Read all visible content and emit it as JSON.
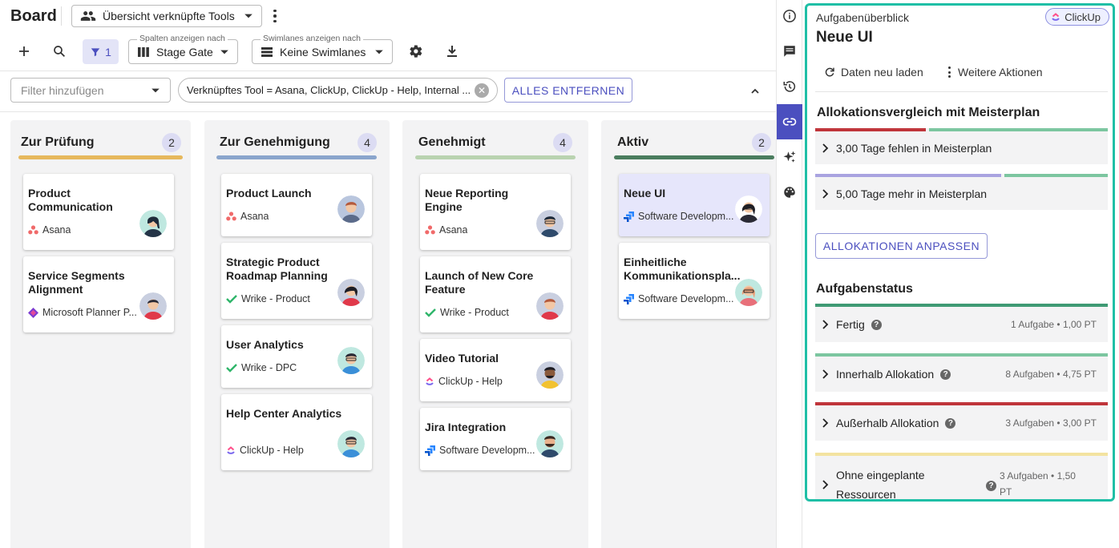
{
  "header": {
    "title": "Board",
    "view_select": "Übersicht verknüpfte Tools",
    "filter_count": "1",
    "columns_select": {
      "label": "Spalten anzeigen nach",
      "value": "Stage Gate"
    },
    "swimlanes_select": {
      "label": "Swimlanes anzeigen nach",
      "value": "Keine Swimlanes"
    },
    "filter_placeholder": "Filter hinzufügen",
    "filter_chip": "Verknüpftes Tool = Asana, ClickUp, ClickUp - Help, Internal ...",
    "clear_all": "ALLES ENTFERNEN"
  },
  "columns": [
    {
      "title": "Zur Prüfung",
      "count": "2",
      "color": "#e6b85c",
      "cards": [
        {
          "title": "Product Communication",
          "tool": "Asana"
        },
        {
          "title": "Service Segments Alignment",
          "tool": "Microsoft Planner P..."
        }
      ]
    },
    {
      "title": "Zur Genehmigung",
      "count": "4",
      "color": "#8aa5cc",
      "cards": [
        {
          "title": "Product Launch",
          "tool": "Asana"
        },
        {
          "title": "Strategic Product Roadmap Planning",
          "tool": "Wrike - Product"
        },
        {
          "title": "User Analytics",
          "tool": "Wrike - DPC"
        },
        {
          "title": "Help Center Analytics",
          "tool": "ClickUp - Help"
        }
      ]
    },
    {
      "title": "Genehmigt",
      "count": "4",
      "color": "#b9d3b0",
      "cards": [
        {
          "title": "Neue Reporting Engine",
          "tool": "Asana"
        },
        {
          "title": "Launch of New Core Feature",
          "tool": "Wrike - Product"
        },
        {
          "title": "Video Tutorial",
          "tool": "ClickUp - Help"
        },
        {
          "title": "Jira Integration",
          "tool": "Software Developm..."
        }
      ]
    },
    {
      "title": "Aktiv",
      "count": "2",
      "color": "#4a7d5e",
      "cards": [
        {
          "title": "Neue UI",
          "tool": "Software Developm..."
        },
        {
          "title": "Einheitliche Kommunikationspla...",
          "tool": "Software Developm..."
        }
      ]
    }
  ],
  "panel": {
    "subtitle": "Aufgabenüberblick",
    "badge": "ClickUp",
    "title": "Neue UI",
    "reload": "Daten neu laden",
    "more": "Weitere Aktionen",
    "alloc_heading": "Allokationsvergleich mit Meisterplan",
    "alloc_rows": [
      {
        "label": "3,00 Tage fehlen in Meisterplan",
        "bar_left": "#c0353b",
        "bar_right": "#7cc6a0"
      },
      {
        "label": "5,00 Tage mehr in Meisterplan",
        "bar_left": "#a9a3e0",
        "bar_right": "#7cc6a0"
      }
    ],
    "adjust": "ALLOKATIONEN ANPASSEN",
    "status_heading": "Aufgabenstatus",
    "status_rows": [
      {
        "label": "Fertig",
        "meta": "1 Aufgabe • 1,00 PT",
        "color": "#3f9a74"
      },
      {
        "label": "Innerhalb Allokation",
        "meta": "8 Aufgaben • 4,75 PT",
        "color": "#7cc6a0"
      },
      {
        "label": "Außerhalb Allokation",
        "meta": "3 Aufgaben • 3,00 PT",
        "color": "#c0353b"
      },
      {
        "label_line1": "Ohne eingeplante",
        "label_line2": "Ressourcen",
        "meta_line1": "3 Aufgaben • 1,50",
        "meta_line2": "PT",
        "color": "#f3e3a0"
      }
    ]
  }
}
